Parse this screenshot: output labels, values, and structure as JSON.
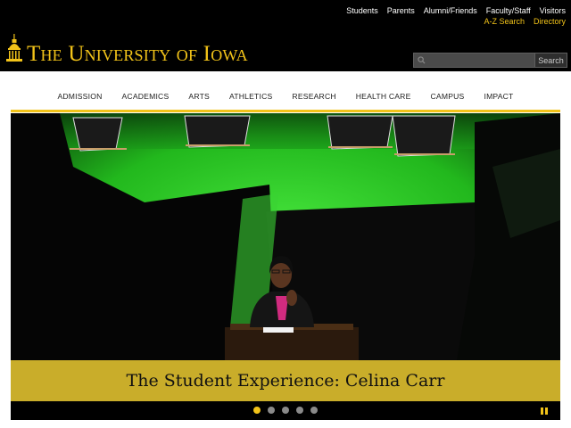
{
  "header": {
    "utility_links_row1": [
      "Students",
      "Parents",
      "Alumni/Friends",
      "Faculty/Staff",
      "Visitors"
    ],
    "utility_links_row2": [
      "A-Z Search",
      "Directory"
    ],
    "logo_text": "The University of Iowa",
    "search": {
      "placeholder": "",
      "button_label": "Search"
    }
  },
  "main_nav": [
    "ADMISSION",
    "ACADEMICS",
    "ARTS",
    "ATHLETICS",
    "RESEARCH",
    "HEALTH CARE",
    "CAMPUS",
    "IMPACT"
  ],
  "hero": {
    "caption": "The Student Experience: Celina Carr",
    "slide_count": 5,
    "active_slide": 1
  },
  "colors": {
    "brand_gold": "#f2c319",
    "caption_gold": "#c9ad2a",
    "header_black": "#000000"
  }
}
